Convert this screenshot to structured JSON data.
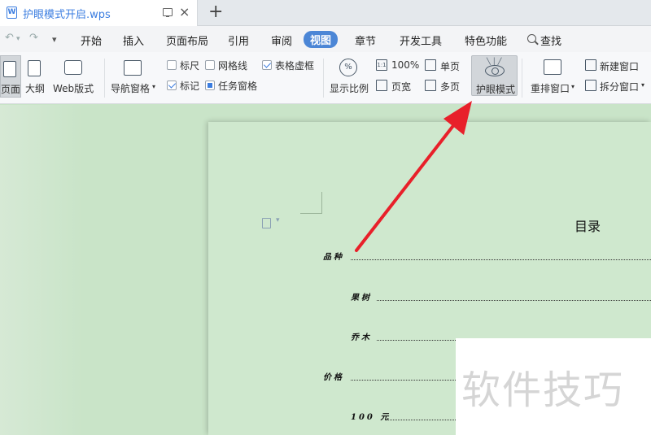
{
  "tab": {
    "title": "护眼模式开启.wps",
    "close": "×",
    "add": "+"
  },
  "quick_access": {
    "undo": "↶",
    "redo": "↷",
    "more": "▾"
  },
  "menu": {
    "items": [
      "开始",
      "插入",
      "页面布局",
      "引用",
      "审阅",
      "视图",
      "章节",
      "开发工具",
      "特色功能"
    ],
    "active": "视图",
    "search_label": "查找"
  },
  "ribbon": {
    "page_view": "页面",
    "outline": "大纲",
    "web_view": "Web版式",
    "nav_pane": "导航窗格",
    "ruler": "标尺",
    "gridlines": "网格线",
    "table_gridlines": "表格虚框",
    "marks": "标记",
    "task_pane": "任务窗格",
    "zoom_ratio": "显示比例",
    "zoom_100": "100%",
    "page_width": "页宽",
    "single_page": "单页",
    "multi_page": "多页",
    "eye_mode": "护眼模式",
    "rearrange_windows": "重排窗口",
    "new_window": "新建窗口",
    "split_window": "拆分窗口",
    "dropdown": "▾"
  },
  "checkbox_states": {
    "ruler": false,
    "gridlines": false,
    "table_gridlines": true,
    "marks": true,
    "task_pane": true
  },
  "document": {
    "toc_title": "目录",
    "toc_entries": [
      "品种",
      "果树",
      "乔木",
      "价格",
      "100 元"
    ]
  },
  "watermark": "软件技巧",
  "colors": {
    "accent": "#4b86d6",
    "eye_bg": "#c9e4c8",
    "arrow": "#e8202a"
  }
}
